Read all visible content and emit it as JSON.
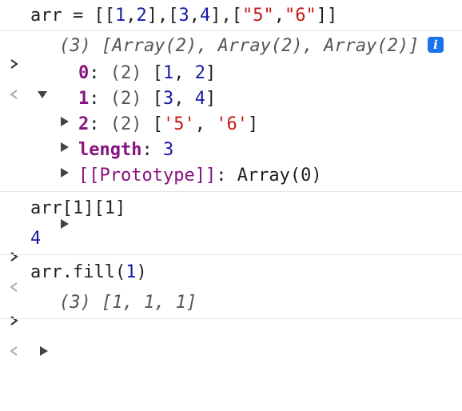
{
  "input1": {
    "code_prefix": "arr = [[",
    "n1": "1",
    "c1": ",",
    "n2": "2",
    "mid1": "],[",
    "n3": "3",
    "c2": ",",
    "n4": "4",
    "mid2": "],[",
    "s1": "\"5\"",
    "c3": ",",
    "s2": "\"6\"",
    "code_suffix": "]]"
  },
  "output1": {
    "summary": "(3) [Array(2), Array(2), Array(2)]",
    "info": "i",
    "items": [
      {
        "key": "0",
        "count": "(2)",
        "open": "[",
        "a": "1",
        "sep": ", ",
        "b": "2",
        "close": "]"
      },
      {
        "key": "1",
        "count": "(2)",
        "open": "[",
        "a": "3",
        "sep": ", ",
        "b": "4",
        "close": "]"
      },
      {
        "key": "2",
        "count": "(2)",
        "open": "[",
        "a": "'5'",
        "sep": ", ",
        "b": "'6'",
        "close": "]"
      }
    ],
    "length_key": "length",
    "length_value": "3",
    "prototype_key": "[[Prototype]]",
    "prototype_value": "Array(0)"
  },
  "input2": {
    "code": "arr[1][1]"
  },
  "output2": {
    "value": "4"
  },
  "input3": {
    "prefix": "arr.fill(",
    "arg": "1",
    "suffix": ")"
  },
  "output3": {
    "summary": "(3) [1, 1, 1]"
  },
  "colors": {
    "number": "#1a1aa6",
    "string": "#c41a16",
    "key": "#881280",
    "info_badge": "#1a73e8"
  },
  "icons": {
    "input_prompt": "chevron-right-icon",
    "output_prompt": "chevron-left-icon",
    "expanded": "triangle-down-icon",
    "collapsed": "triangle-right-icon",
    "info": "info-icon"
  }
}
